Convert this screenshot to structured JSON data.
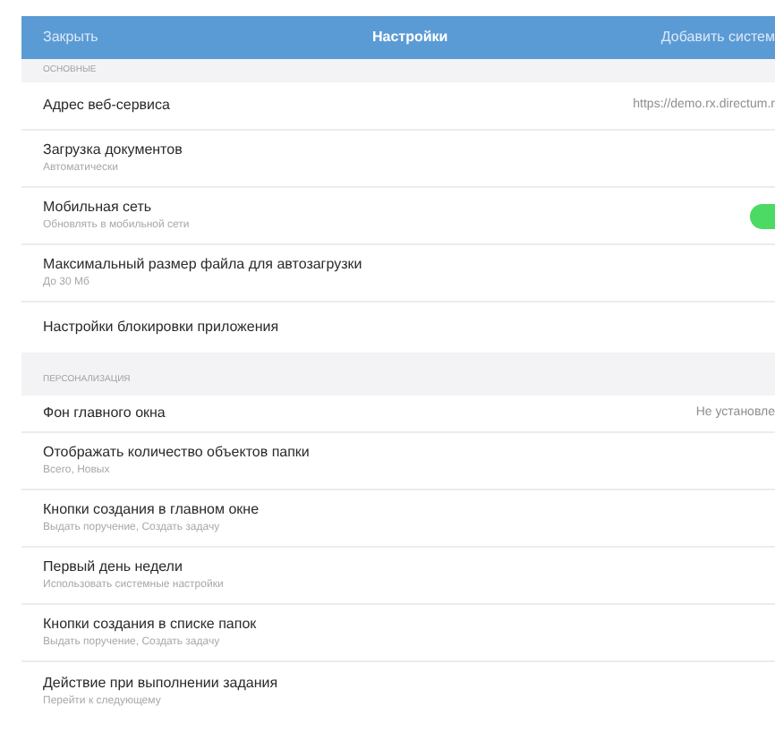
{
  "nav_bar": {
    "left_button": "Закрыть",
    "title": "Настройки",
    "right_button": "Добавить систем"
  },
  "sections": [
    {
      "title": "ОСНОВНЫЕ",
      "rows": [
        {
          "kind": "value",
          "title": "Адрес веб-сервиса",
          "value": "https://demo.rx.directum.r"
        },
        {
          "kind": "plain",
          "title": "Загрузка документов",
          "subtitle": "Автоматически"
        },
        {
          "kind": "toggle",
          "title": "Мобильная сеть",
          "subtitle": "Обновлять в мобильной сети",
          "on": true
        },
        {
          "kind": "plain",
          "title": "Максимальный размер файла для автозагрузки",
          "subtitle": "До 30 Мб"
        },
        {
          "kind": "plain",
          "title": "Настройки блокировки приложения"
        }
      ]
    },
    {
      "title": "ПЕРСОНАЛИЗАЦИЯ",
      "rows": [
        {
          "kind": "value",
          "title": "Фон главного окна",
          "value": "Не установле"
        },
        {
          "kind": "plain",
          "title": "Отображать количество объектов папки",
          "subtitle": "Всего, Новых"
        },
        {
          "kind": "plain",
          "title": "Кнопки создания в главном окне",
          "subtitle": "Выдать поручение, Создать задачу"
        },
        {
          "kind": "plain",
          "title": "Первый день недели",
          "subtitle": "Использовать системные настройки"
        },
        {
          "kind": "plain",
          "title": "Кнопки создания в списке папок",
          "subtitle": "Выдать поручение, Создать задачу"
        },
        {
          "kind": "plain",
          "title": "Действие при выполнении задания",
          "subtitle": "Перейти к следующему"
        }
      ]
    }
  ]
}
